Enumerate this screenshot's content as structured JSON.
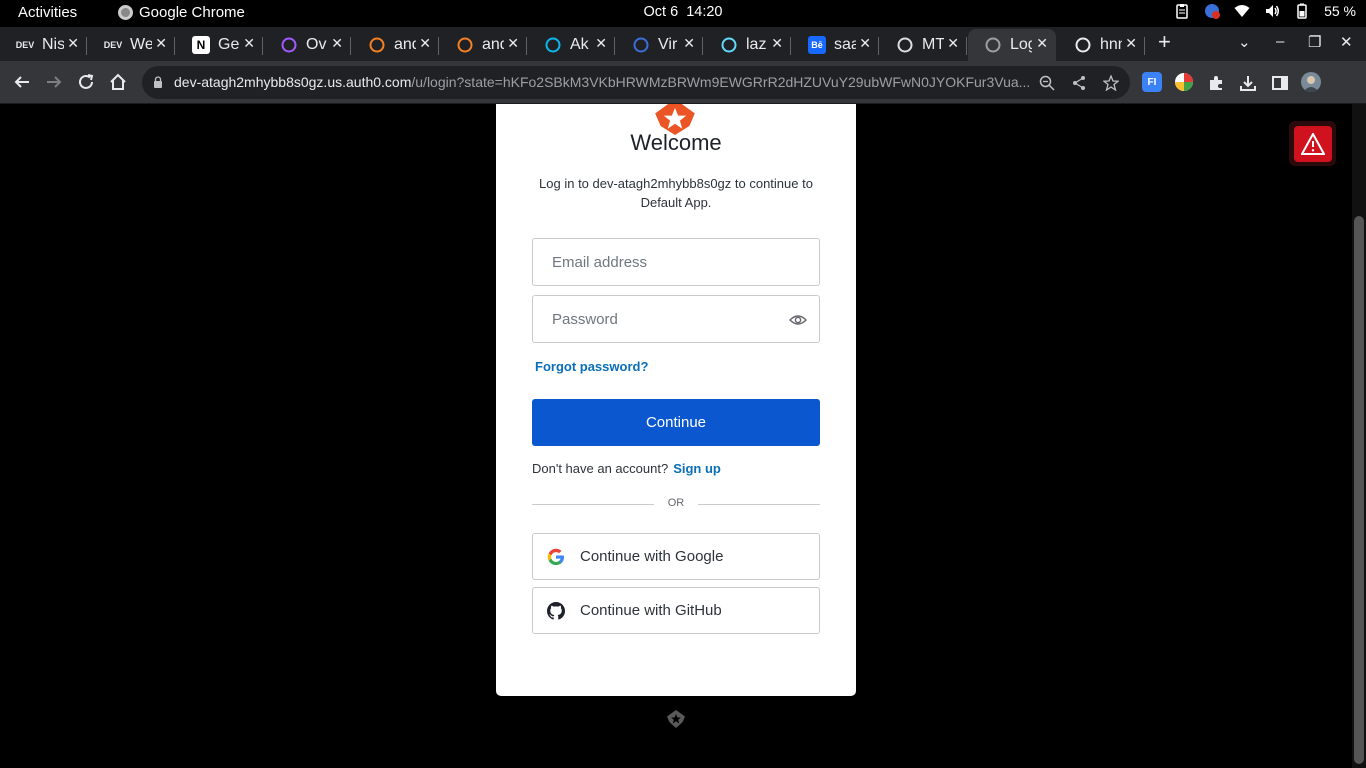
{
  "os": {
    "activities_label": "Activities",
    "app_name": "Google Chrome",
    "date": "Oct 6",
    "time": "14:20",
    "battery_percent": "55 %"
  },
  "browser": {
    "tabs": [
      {
        "icon": "dev-icon",
        "favicon_text": "DEV",
        "title": "Nis"
      },
      {
        "icon": "dev-icon",
        "favicon_text": "DEV",
        "title": "We"
      },
      {
        "icon": "notion-icon",
        "favicon_text": "N",
        "title": "Ger"
      },
      {
        "icon": "figma-icon",
        "favicon_text": "",
        "title": "Ov"
      },
      {
        "icon": "stackoverflow-icon",
        "favicon_text": "",
        "title": "and"
      },
      {
        "icon": "stackoverflow-icon",
        "favicon_text": "",
        "title": "and"
      },
      {
        "icon": "c-icon",
        "favicon_text": "",
        "title": "Ak"
      },
      {
        "icon": "grid-icon",
        "favicon_text": "",
        "title": "Vir"
      },
      {
        "icon": "react-icon",
        "favicon_text": "",
        "title": "laz"
      },
      {
        "icon": "behance-icon",
        "favicon_text": "Bē",
        "title": "saa"
      },
      {
        "icon": "mt-icon",
        "favicon_text": "",
        "title": "MT"
      },
      {
        "icon": "globe-icon",
        "favicon_text": "",
        "title": "Log",
        "active": true
      },
      {
        "icon": "github-icon",
        "favicon_text": "",
        "title": "hnn"
      }
    ],
    "url_host": "dev-atagh2mhybb8s0gz.us.auth0.com",
    "url_path": "/u/login?state=hKFo2SBkM3VKbHRWMzBRWm9EWGRrR2dHZUVuY29ubWFwN0JYOKFur3Vua..."
  },
  "login": {
    "title": "Welcome",
    "intro": "Log in to dev-atagh2mhybb8s0gz to continue to Default App.",
    "email_placeholder": "Email address",
    "password_placeholder": "Password",
    "forgot_label": "Forgot password?",
    "continue_label": "Continue",
    "no_account_text": "Don't have an account?",
    "signup_label": "Sign up",
    "or_label": "OR",
    "google_label": "Continue with Google",
    "github_label": "Continue with GitHub"
  },
  "colors": {
    "primary": "#0b57d0",
    "link": "#0a6fb7",
    "warning": "#d0121f",
    "auth0_orange": "#eb5424"
  }
}
